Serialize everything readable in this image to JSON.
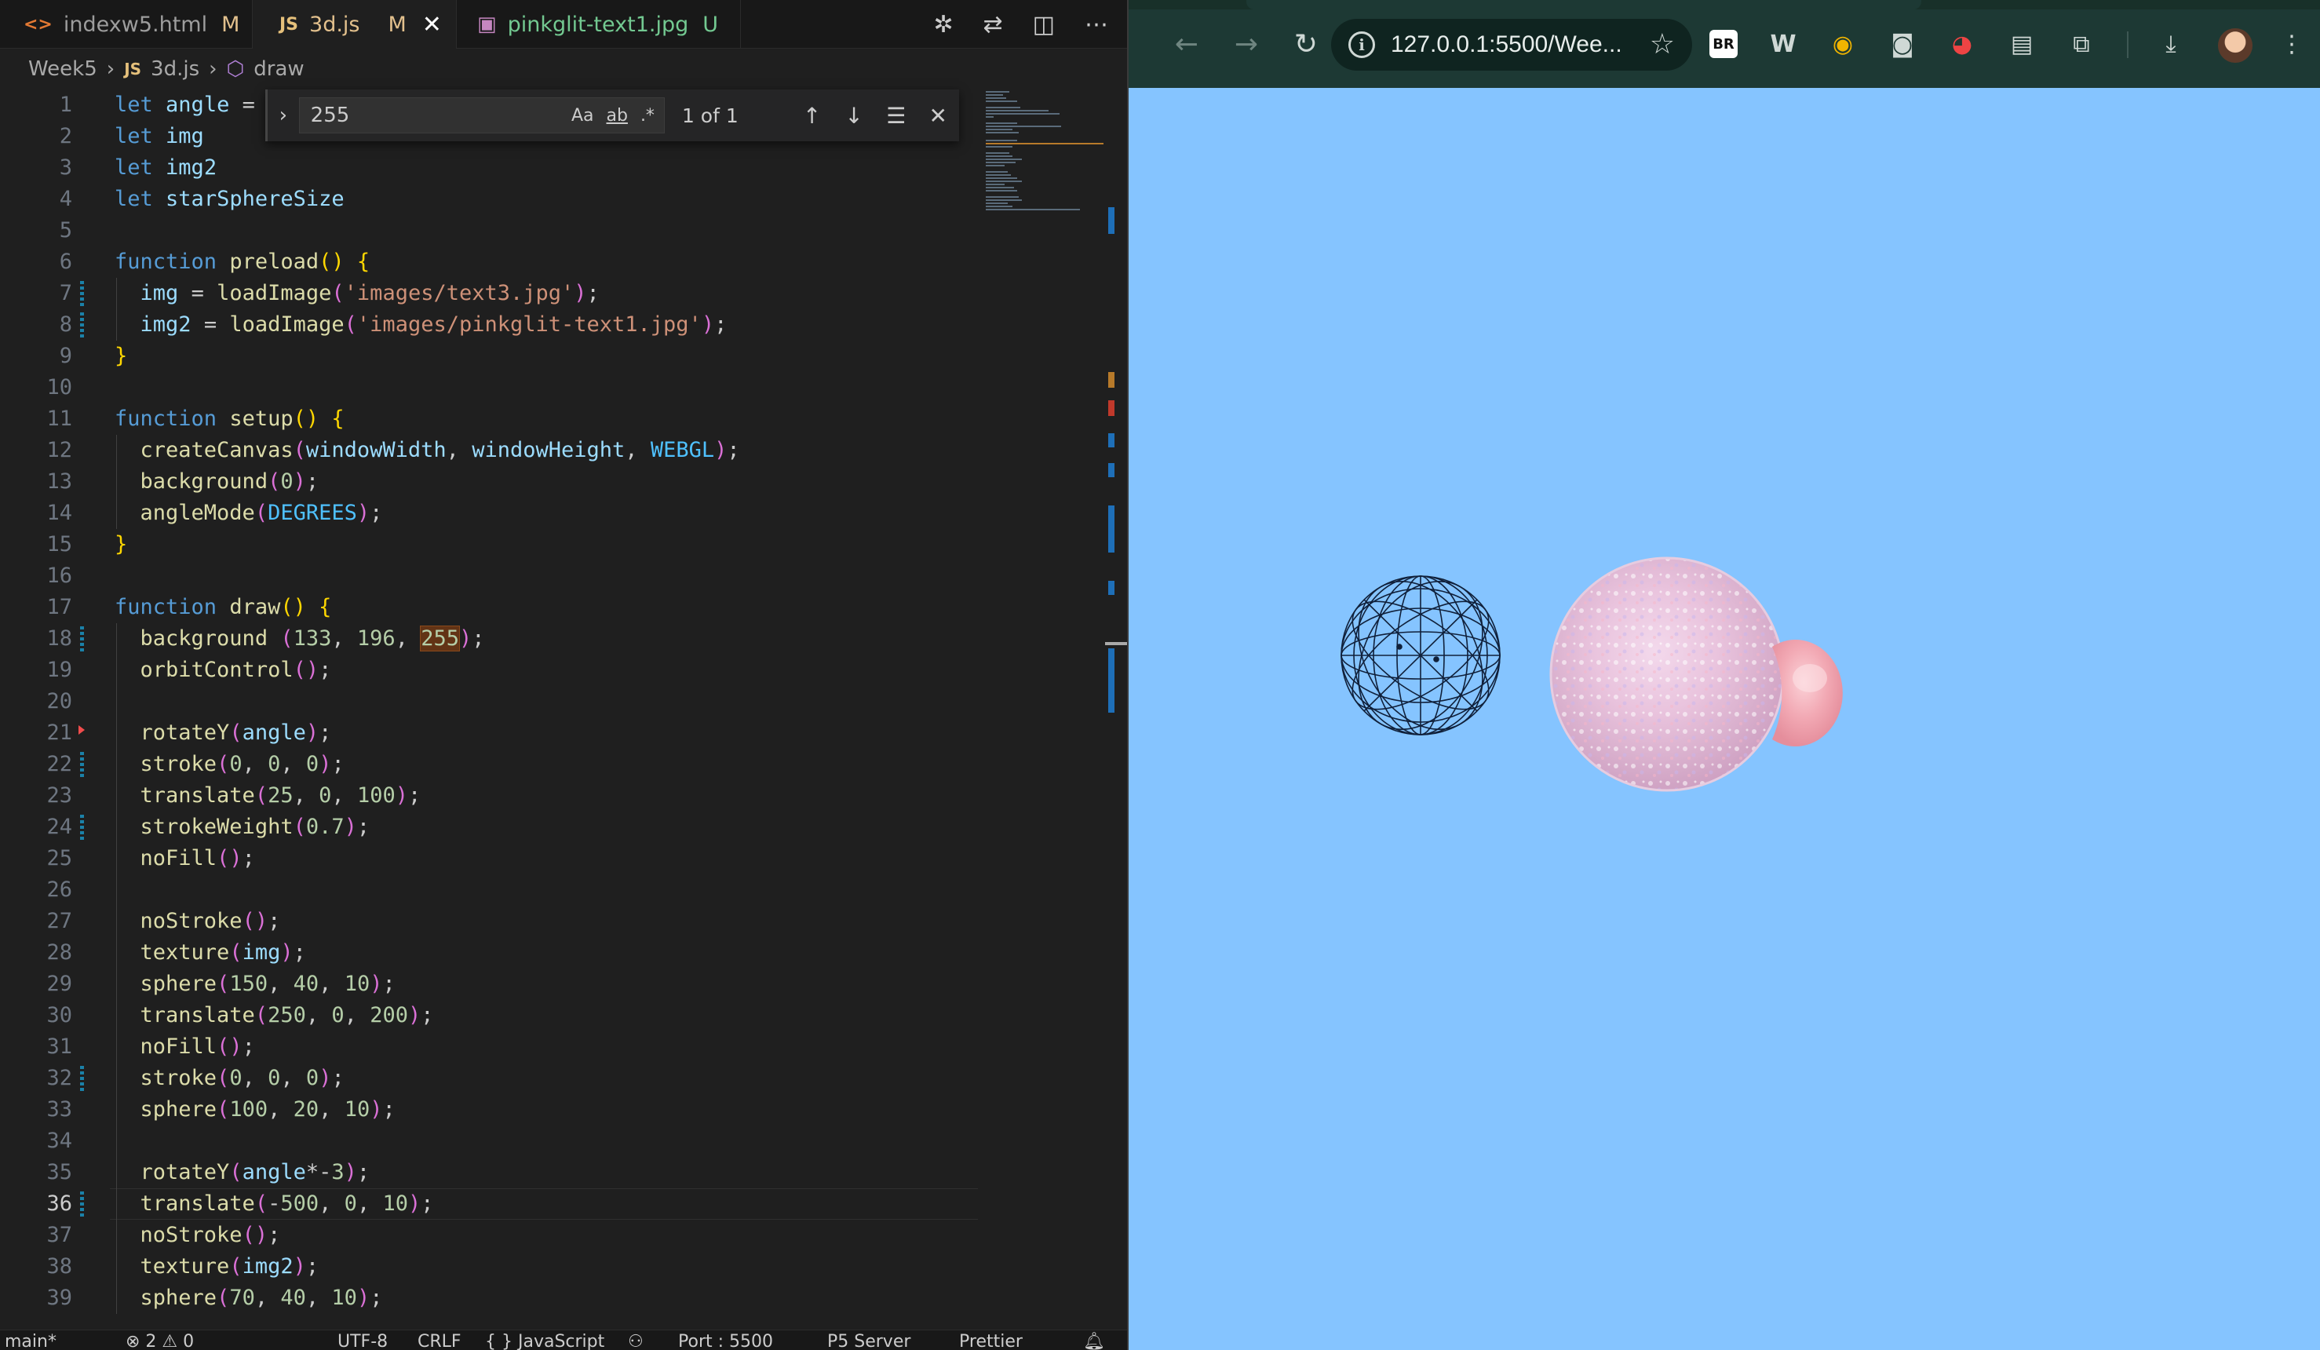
{
  "editor": {
    "tabs": [
      {
        "icon": "<>",
        "name": "indexw5.html",
        "status": "M"
      },
      {
        "icon": "JS",
        "name": "3d.js",
        "status": "M"
      },
      {
        "icon": "img",
        "name": "pinkglit-text1.jpg",
        "status": "U"
      }
    ],
    "breadcrumb": {
      "folder": "Week5",
      "file": "3d.js",
      "symbol": "draw"
    },
    "find": {
      "query": "255",
      "options": [
        "Aa",
        "ab",
        ".*"
      ],
      "count": "1 of 1"
    },
    "line_numbers": [
      "1",
      "2",
      "3",
      "4",
      "5",
      "6",
      "7",
      "8",
      "9",
      "10",
      "11",
      "12",
      "13",
      "14",
      "15",
      "16",
      "17",
      "18",
      "19",
      "20",
      "21",
      "22",
      "23",
      "24",
      "25",
      "26",
      "27",
      "28",
      "29",
      "30",
      "31",
      "32",
      "33",
      "34",
      "35",
      "36",
      "37",
      "38",
      "39"
    ],
    "status": {
      "branch": "main*",
      "problems": "⊗ 2 ⚠ 0",
      "encoding": "UTF-8",
      "eol": "CRLF",
      "language": "{ } JavaScript",
      "port": "Port : 5500",
      "p5": "P5 Server",
      "prettier": "Prettier"
    }
  },
  "browser": {
    "url": "127.0.0.1:5500/Wee...",
    "background_color": "#85c4ff",
    "extensions": [
      "BR",
      "W",
      "eye",
      "camera",
      "color",
      "doc",
      "puzzle"
    ]
  }
}
